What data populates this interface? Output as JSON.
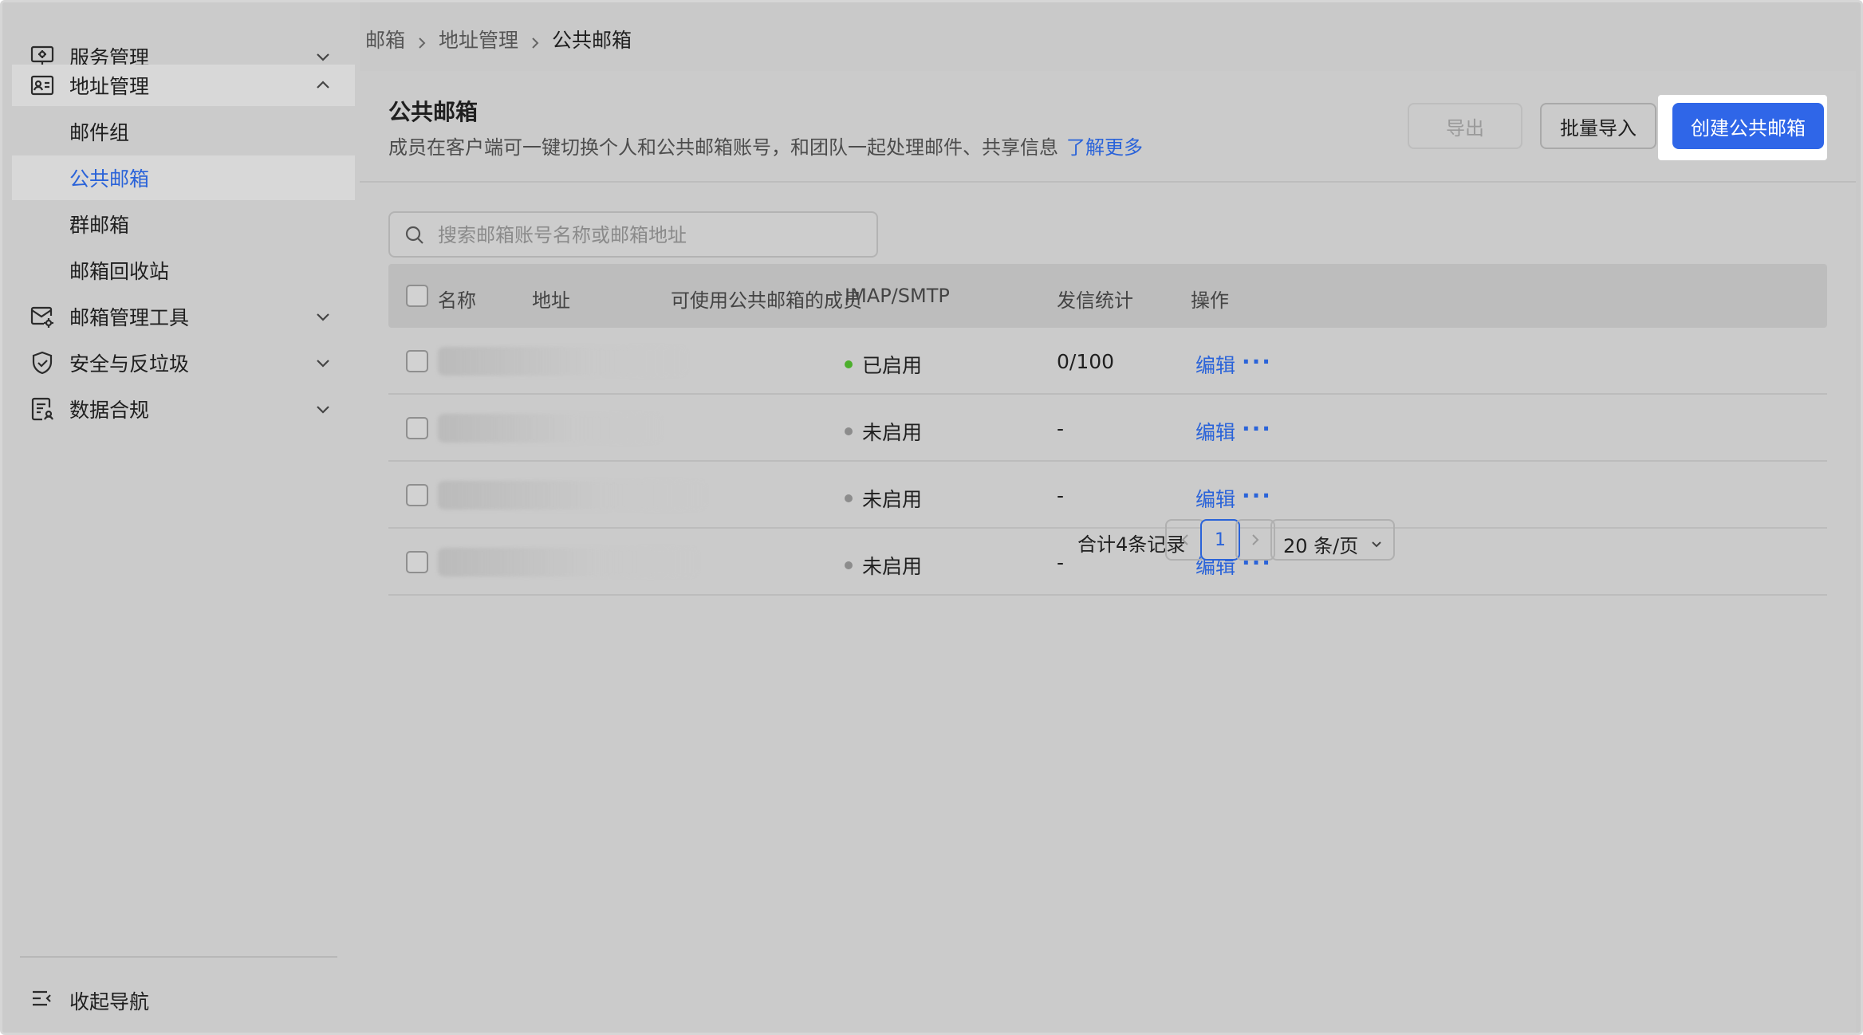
{
  "sidebar": {
    "groups": [
      {
        "label": "服务管理",
        "icon": "monitor-settings-icon",
        "expanded": false
      },
      {
        "label": "地址管理",
        "icon": "address-card-icon",
        "expanded": true
      },
      {
        "label": "邮箱管理工具",
        "icon": "mail-settings-icon",
        "expanded": false
      },
      {
        "label": "安全与反垃圾",
        "icon": "shield-check-icon",
        "expanded": false
      },
      {
        "label": "数据合规",
        "icon": "data-compliance-icon",
        "expanded": false
      }
    ],
    "address_sub_items": [
      {
        "label": "邮件组"
      },
      {
        "label": "公共邮箱",
        "selected": true
      },
      {
        "label": "群邮箱"
      },
      {
        "label": "邮箱回收站"
      }
    ],
    "collapse_label": "收起导航"
  },
  "breadcrumb": {
    "items": [
      "邮箱",
      "地址管理",
      "公共邮箱"
    ]
  },
  "header": {
    "title": "公共邮箱",
    "description": "成员在客户端可一键切换个人和公共邮箱账号，和团队一起处理邮件、共享信息",
    "learn_more": "了解更多",
    "export_label": "导出",
    "import_label": "批量导入",
    "create_label": "创建公共邮箱"
  },
  "search": {
    "placeholder": "搜索邮箱账号名称或邮箱地址",
    "value": ""
  },
  "table": {
    "columns": [
      "名称",
      "地址",
      "可使用公共邮箱的成员",
      "IMAP/SMTP",
      "发信统计",
      "操作"
    ],
    "rows": [
      {
        "imap_status": "已启用",
        "status_color": "#4caf2c",
        "send_stats": "0/100",
        "action": "编辑",
        "more": "···"
      },
      {
        "imap_status": "未启用",
        "status_color": "#8c8c8c",
        "send_stats": "-",
        "action": "编辑",
        "more": "···"
      },
      {
        "imap_status": "未启用",
        "status_color": "#8c8c8c",
        "send_stats": "-",
        "action": "编辑",
        "more": "···"
      },
      {
        "imap_status": "未启用",
        "status_color": "#8c8c8c",
        "send_stats": "-",
        "action": "编辑",
        "more": "···"
      }
    ]
  },
  "pagination": {
    "total_text": "合计4条记录",
    "current_page": "1",
    "page_size": "20 条/页"
  },
  "colors": {
    "accent": "#2f66e8",
    "link": "#2a63d9"
  }
}
